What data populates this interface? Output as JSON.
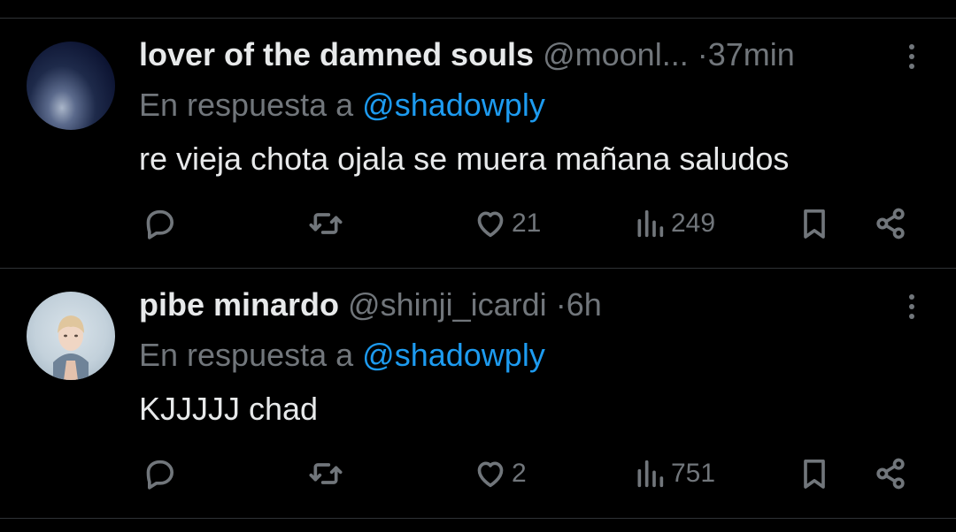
{
  "tweets": [
    {
      "name": "lover of the damned souls",
      "handle": "@moonl...",
      "dot": "·",
      "time": "37min",
      "reply_prefix": "En respuesta a",
      "reply_to": "@shadowply",
      "text": "re vieja chota ojala se muera mañana saludos",
      "likes": "21",
      "views": "249"
    },
    {
      "name": "pibe minardo",
      "handle": "@shinji_icardi",
      "dot": "·",
      "time": "6h",
      "reply_prefix": "En respuesta a",
      "reply_to": "@shadowply",
      "text": "KJJJJJ chad",
      "likes": "2",
      "views": "751"
    }
  ],
  "colors": {
    "background": "#000000",
    "text": "#e7e9ea",
    "muted": "#71767b",
    "mention": "#1d9bf0",
    "divider": "#2f3336"
  },
  "icons": [
    "reply-icon",
    "retweet-icon",
    "like-icon",
    "views-icon",
    "bookmark-icon",
    "share-icon",
    "more-icon"
  ]
}
